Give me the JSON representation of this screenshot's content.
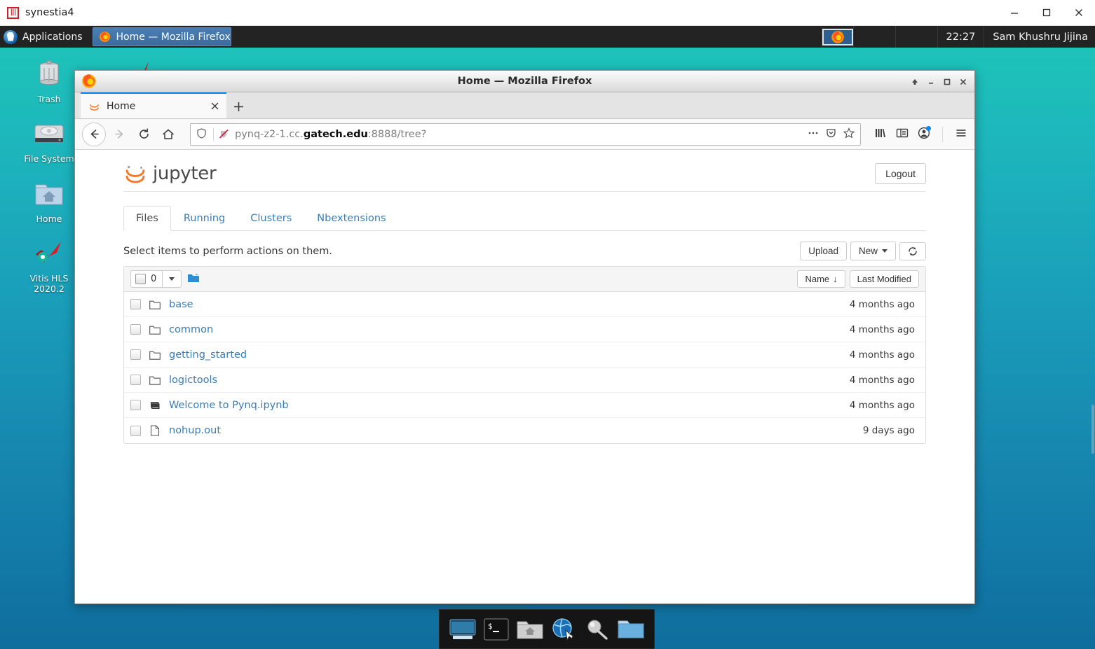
{
  "outer_window": {
    "title": "synestia4",
    "icon": "synestia-icon",
    "controls": [
      {
        "name": "minimize-button",
        "glyph": "minimize-icon"
      },
      {
        "name": "maximize-button",
        "glyph": "maximize-icon"
      },
      {
        "name": "close-button",
        "glyph": "close-icon"
      }
    ]
  },
  "panel": {
    "applications_label": "Applications",
    "applications_icon": "mouse-cursor-icon",
    "task_button": {
      "label": "Home — Mozilla Firefox",
      "icon": "firefox-icon"
    },
    "tray_icon": "firefox-tray-icon",
    "clock": "22:27",
    "user": "Sam Khushru Jijina"
  },
  "desktop": {
    "icons": [
      {
        "label": "Trash",
        "icon": "trash-icon"
      },
      {
        "label": "File System",
        "icon": "harddisk-icon"
      },
      {
        "label": "Home",
        "icon": "home-folder-icon"
      },
      {
        "label": "Vitis HLS\n2020.2",
        "icon": "vitis-hls-icon",
        "line1": "Vitis HLS",
        "line2": "2020.2"
      }
    ]
  },
  "firefox": {
    "window_title": "Home — Mozilla Firefox",
    "window_controls": [
      {
        "name": "shade-button",
        "glyph": "arrow-up-icon"
      },
      {
        "name": "minimize-button",
        "glyph": "minimize-icon"
      },
      {
        "name": "maximize-button",
        "glyph": "maximize-icon"
      },
      {
        "name": "close-button",
        "glyph": "close-icon"
      }
    ],
    "tab": {
      "title": "Home",
      "favicon": "jupyter-favicon",
      "close_icon": "close-icon"
    },
    "new_tab_label": "+",
    "nav": {
      "back_icon": "arrow-left-icon",
      "forward_icon": "arrow-right-icon",
      "reload_icon": "reload-icon",
      "home_icon": "home-icon"
    },
    "urlbar": {
      "shield_icon": "shield-icon",
      "tracking_icon": "tracking-protection-disabled-icon",
      "url_prefix": "pynq-z2-1.cc.",
      "url_domain": "gatech.edu",
      "url_suffix": ":8888/tree?",
      "full_url": "pynq-z2-1.cc.gatech.edu:8888/tree?",
      "page_actions_icon": "ellipsis-icon",
      "pocket_icon": "pocket-icon",
      "bookmark_icon": "star-icon"
    },
    "toolbar_icons": [
      {
        "name": "library-icon"
      },
      {
        "name": "sidebar-icon"
      },
      {
        "name": "account-icon"
      },
      {
        "name": "hamburger-menu-icon"
      }
    ]
  },
  "jupyter": {
    "logo_text": "jupyter",
    "logout_label": "Logout",
    "tabs": [
      {
        "label": "Files",
        "active": true
      },
      {
        "label": "Running",
        "active": false
      },
      {
        "label": "Clusters",
        "active": false
      },
      {
        "label": "Nbextensions",
        "active": false
      }
    ],
    "hint": "Select items to perform actions on them.",
    "actions": {
      "upload_label": "Upload",
      "new_label": "New",
      "refresh_icon": "refresh-icon"
    },
    "list_toolbar": {
      "select_count": "0",
      "select_caret_icon": "chevron-down-icon",
      "folder_icon": "blue-folder-icon",
      "sort_name_label": "Name",
      "sort_name_arrow": "↓",
      "sort_modified_label": "Last Modified"
    },
    "files": [
      {
        "name": "base",
        "type": "folder",
        "icon": "folder-icon",
        "modified": "4 months ago"
      },
      {
        "name": "common",
        "type": "folder",
        "icon": "folder-icon",
        "modified": "4 months ago"
      },
      {
        "name": "getting_started",
        "type": "folder",
        "icon": "folder-icon",
        "modified": "4 months ago"
      },
      {
        "name": "logictools",
        "type": "folder",
        "icon": "folder-icon",
        "modified": "4 months ago"
      },
      {
        "name": "Welcome to Pynq.ipynb",
        "type": "notebook",
        "icon": "notebook-icon",
        "modified": "4 months ago"
      },
      {
        "name": "nohup.out",
        "type": "file",
        "icon": "file-icon",
        "modified": "9 days ago"
      }
    ]
  },
  "dock": {
    "items": [
      {
        "name": "show-desktop-icon"
      },
      {
        "name": "terminal-icon"
      },
      {
        "name": "home-folder-icon"
      },
      {
        "name": "web-browser-icon"
      },
      {
        "name": "search-icon"
      },
      {
        "name": "file-manager-icon"
      }
    ]
  },
  "colors": {
    "accent_blue": "#0a84ff",
    "jupyter_orange": "#f37726",
    "link_blue": "#3b7cb5",
    "desktop_top": "#1fc9b9",
    "desktop_bottom": "#0f6d9c",
    "panel_bg": "#232323"
  }
}
